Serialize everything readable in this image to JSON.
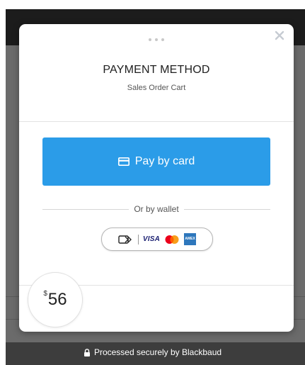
{
  "modal": {
    "title": "PAYMENT METHOD",
    "subtitle": "Sales Order Cart",
    "close_icon": "close-icon",
    "pay_button": {
      "label": "Pay by card",
      "icon": "credit-card-icon",
      "color": "#2b9ce8"
    },
    "wallet_separator": "Or by wallet",
    "wallet_button": {
      "icons": [
        "contactless-wallet-icon",
        "visa-logo",
        "mastercard-logo",
        "amex-logo"
      ],
      "visa_text": "VISA",
      "amex_text": "AMEX"
    },
    "amount": {
      "currency": "$",
      "value": "56"
    }
  },
  "footer": {
    "icon": "lock-icon",
    "text": "Processed securely by Blackbaud"
  }
}
